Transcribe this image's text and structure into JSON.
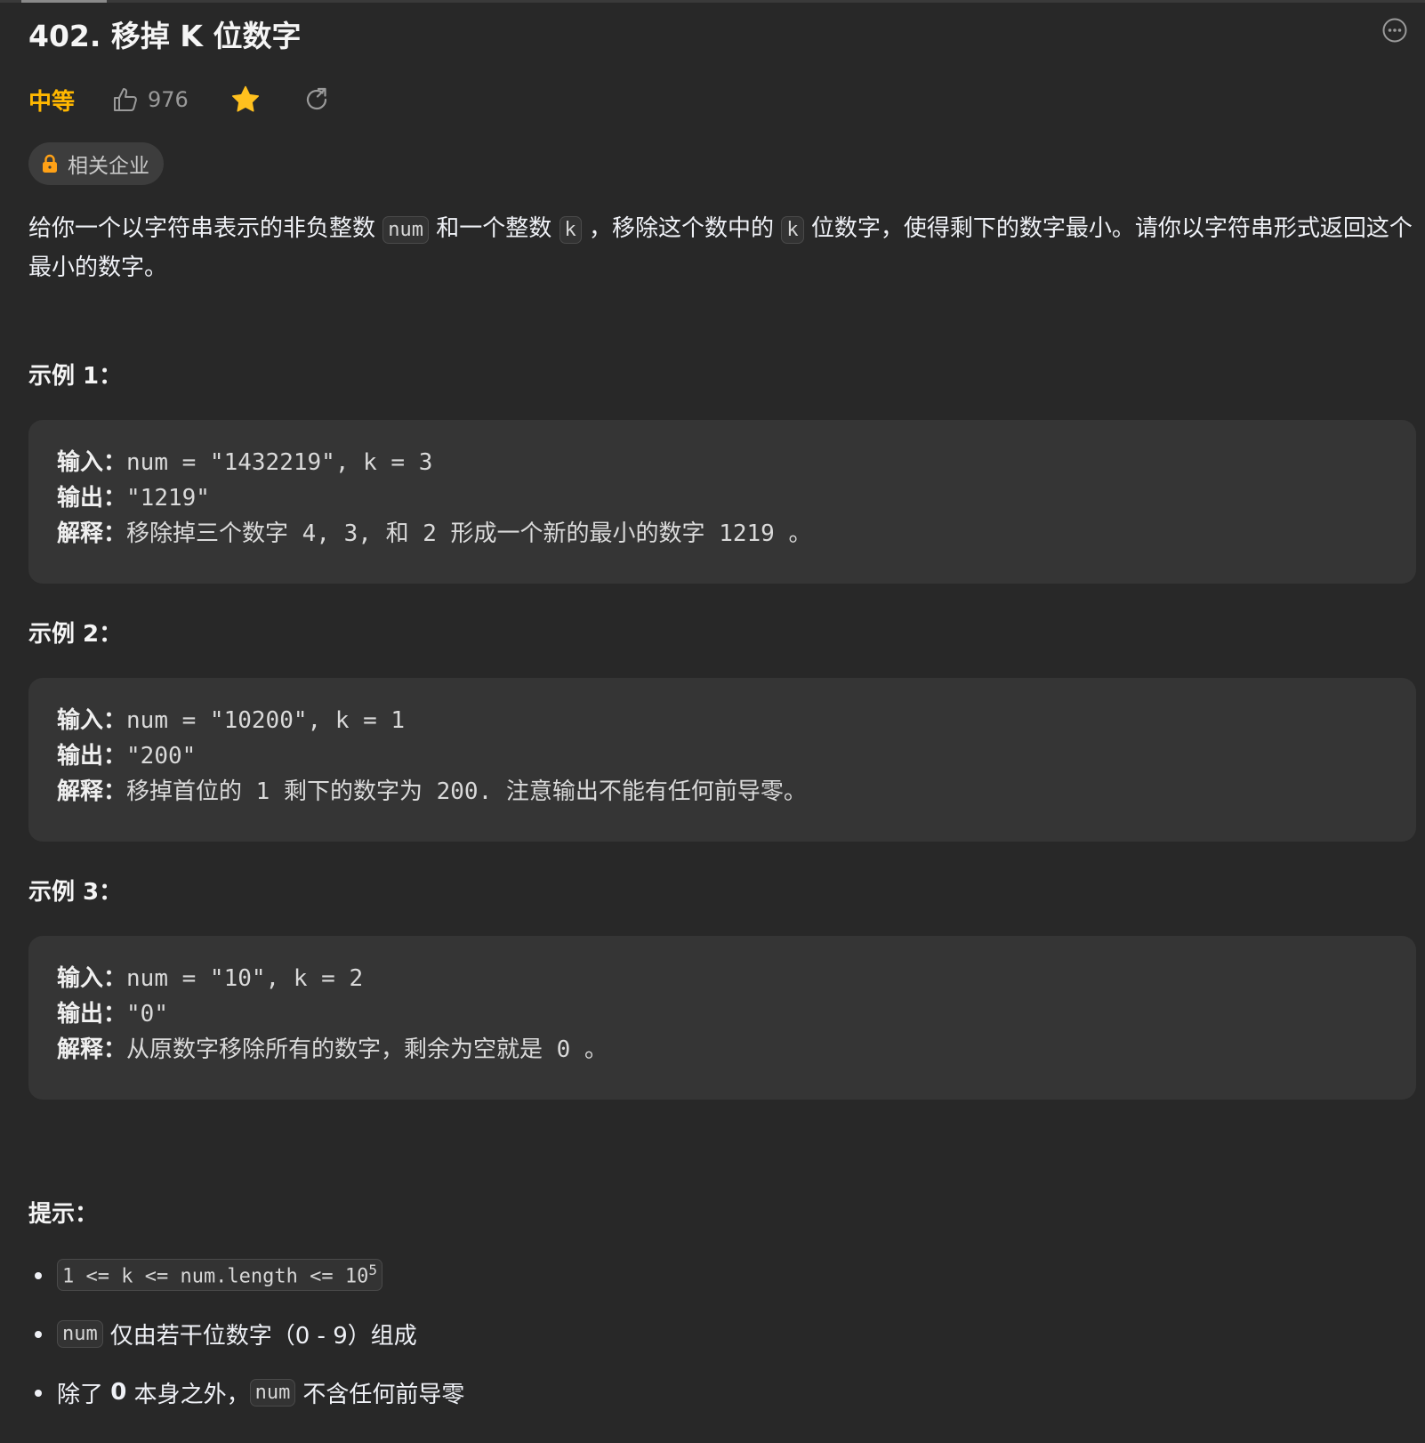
{
  "problem": {
    "title": "402. 移掉 K 位数字",
    "difficulty": "中等",
    "likes": "976",
    "company_tag": "相关企业"
  },
  "description": {
    "part1": "给你一个以字符串表示的非负整数 ",
    "code1": "num",
    "part2": " 和一个整数 ",
    "code2": "k",
    "part3": " ，移除这个数中的 ",
    "code3": "k",
    "part4": " 位数字，使得剩下的数字最小。请你以字符串形式返回这个最小的数字。"
  },
  "examples": [
    {
      "title": "示例 1：",
      "input_label": "输入：",
      "input": "num = \"1432219\", k = 3",
      "output_label": "输出：",
      "output": "\"1219\"",
      "explain_label": "解释：",
      "explain": "移除掉三个数字 4, 3, 和 2 形成一个新的最小的数字 1219 。"
    },
    {
      "title": "示例 2：",
      "input_label": "输入：",
      "input": "num = \"10200\", k = 1",
      "output_label": "输出：",
      "output": "\"200\"",
      "explain_label": "解释：",
      "explain": "移掉首位的 1 剩下的数字为 200. 注意输出不能有任何前导零。"
    },
    {
      "title": "示例 3：",
      "input_label": "输入：",
      "input": "num = \"10\", k = 2",
      "output_label": "输出：",
      "output": "\"0\"",
      "explain_label": "解释：",
      "explain": "从原数字移除所有的数字，剩余为空就是 0 。"
    }
  ],
  "hints": {
    "title": "提示：",
    "c1_code": "1 <= k <= num.length <= 10",
    "c1_sup": "5",
    "c2_code": "num",
    "c2_text": "仅由若干位数字（0 - 9）组成",
    "c3_pre": "除了 ",
    "c3_bold": "0",
    "c3_mid": " 本身之外，",
    "c3_code": "num",
    "c3_post": "不含任何前导零"
  },
  "colors": {
    "background": "#282828",
    "difficulty": "#ffb700",
    "star": "#ffc01e",
    "code_bg": "#353535"
  },
  "icons": [
    "more-icon",
    "thumbs-up-icon",
    "star-icon",
    "share-icon",
    "lock-icon"
  ]
}
